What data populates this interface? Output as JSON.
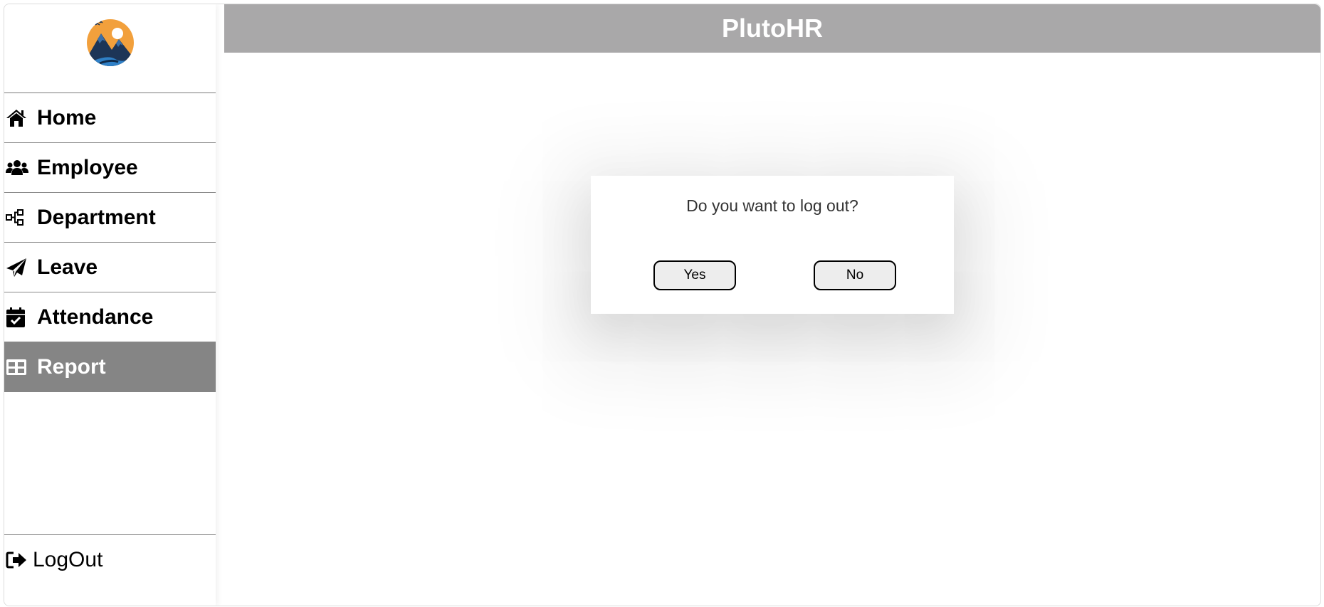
{
  "header": {
    "title": "PlutoHR"
  },
  "sidebar": {
    "logo_icon": "mountain-logo",
    "items": [
      {
        "label": "Home",
        "icon": "home-icon",
        "active": false
      },
      {
        "label": "Employee",
        "icon": "users-icon",
        "active": false
      },
      {
        "label": "Department",
        "icon": "hierarchy-icon",
        "active": false
      },
      {
        "label": "Leave",
        "icon": "paper-plane-icon",
        "active": false
      },
      {
        "label": "Attendance",
        "icon": "calendar-check-icon",
        "active": false
      },
      {
        "label": "Report",
        "icon": "table-icon",
        "active": true
      }
    ],
    "logout": {
      "label": "LogOut",
      "icon": "sign-out-icon"
    }
  },
  "modal": {
    "question": "Do you want to log out?",
    "yes_label": "Yes",
    "no_label": "No"
  },
  "colors": {
    "header_bg": "#a9a8a9",
    "active_item_bg": "#858585",
    "logo_orange": "#f2a03c",
    "logo_navy": "#1d3557"
  }
}
